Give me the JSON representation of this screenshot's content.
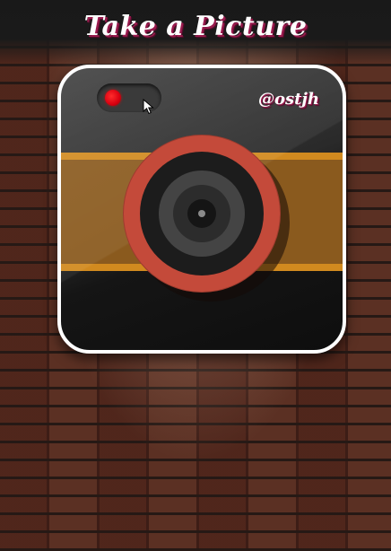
{
  "header": {
    "title": "Take a Picture"
  },
  "camera": {
    "handle": "@ostjh",
    "toggle": {
      "state": "on",
      "indicator_color": "#e0000f"
    },
    "lens": {
      "ring_color": "#c44a3a"
    },
    "stripe_color": "#8a5a1e",
    "stripe_edge_color": "#d18a1f"
  },
  "background": {
    "wall": "brick",
    "accent": "#9a1b4e"
  },
  "icons": [
    "cursor-arrow-icon",
    "lens-icon"
  ]
}
